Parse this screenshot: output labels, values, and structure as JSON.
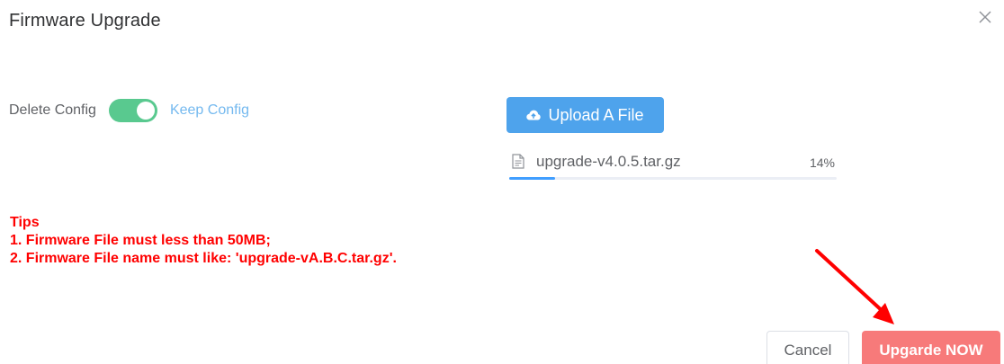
{
  "dialog": {
    "title": "Firmware Upgrade"
  },
  "config_switch": {
    "inactive_label": "Delete Config",
    "active_label": "Keep Config",
    "state": "on",
    "active_color": "#59c98f"
  },
  "upload": {
    "button_label": "Upload A File",
    "icon": "cloud-upload-icon",
    "file": {
      "name": "upgrade-v4.0.5.tar.gz",
      "progress_text": "14%",
      "progress": 0.14,
      "icon": "document-icon"
    }
  },
  "tips": {
    "heading": "Tips",
    "lines": [
      "1. Firmware File must less than 50MB;",
      "2. Firmware File name must like: 'upgrade-vA.B.C.tar.gz'."
    ],
    "color": "#ff0000"
  },
  "footer": {
    "cancel_label": "Cancel",
    "upgrade_label": "Upgarde NOW",
    "upgrade_color": "#f77a7a"
  }
}
